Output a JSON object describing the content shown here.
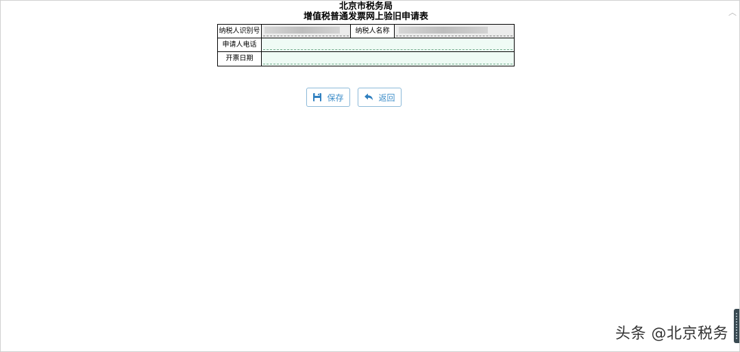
{
  "title": {
    "line1": "北京市税务局",
    "line2": "增值税普通发票网上验旧申请表"
  },
  "form": {
    "taxpayer_id_label": "纳税人识别号",
    "taxpayer_name_label": "纳税人名称",
    "applicant_phone_label": "申请人电话",
    "invoice_date_label": "开票日期",
    "taxpayer_id_value": "",
    "taxpayer_name_value": "",
    "applicant_phone_value": "",
    "invoice_date_value": ""
  },
  "buttons": {
    "save_label": "保存",
    "back_label": "返回"
  },
  "icons": {
    "save": "floppy-disk-icon",
    "back": "reply-arrow-icon"
  },
  "colors": {
    "button_text": "#3b8cc8",
    "button_border": "#8ab8d8",
    "readonly_bg": "#ececec",
    "editable_bg": "#effbf5"
  },
  "watermark": "头条 @北京税务"
}
